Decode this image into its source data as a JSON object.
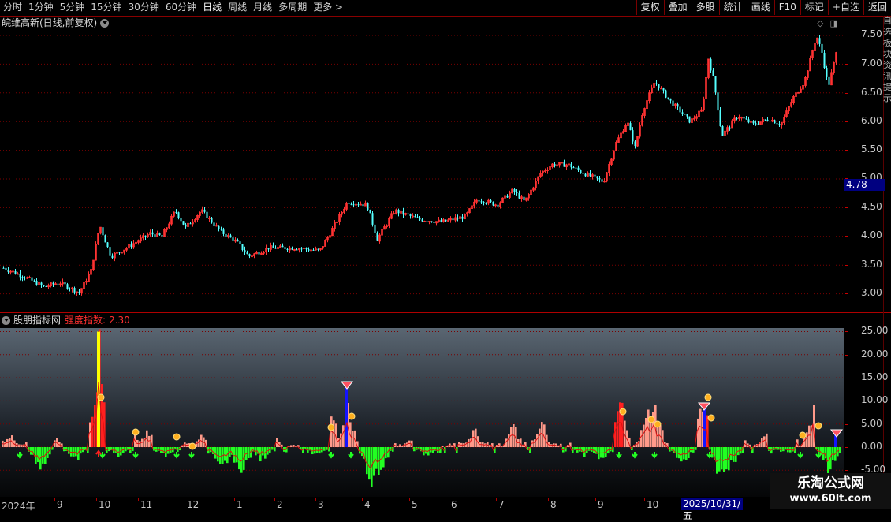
{
  "toolbar": {
    "periods": [
      "分时",
      "1分钟",
      "5分钟",
      "15分钟",
      "30分钟",
      "60分钟",
      "日线",
      "周线",
      "月线",
      "多周期",
      "更多 >"
    ],
    "active_period": "日线",
    "actions": [
      "复权",
      "叠加",
      "多股",
      "统计",
      "画线",
      "F10",
      "标记",
      "+自选",
      "返回"
    ]
  },
  "price_panel": {
    "title": "皖维高新(日线,前复权)",
    "current_price_label": "4.78",
    "y_ticks": [
      "7.50",
      "7.00",
      "6.50",
      "6.00",
      "5.50",
      "5.00",
      "4.50",
      "4.00",
      "3.50",
      "3.00"
    ]
  },
  "indicator_panel": {
    "name": "股朋指标网",
    "label": "强度指数:",
    "value": "2.30",
    "y_ticks": [
      "25.00",
      "20.00",
      "15.00",
      "10.00",
      "5.00",
      "0.00",
      "-5.00"
    ]
  },
  "x_axis": {
    "labels": [
      "2024年",
      "9",
      "10",
      "11",
      "12",
      "1",
      "2",
      "3",
      "4",
      "5",
      "6",
      "7",
      "8",
      "9",
      "10"
    ],
    "selected_date": "2025/10/31/五"
  },
  "right_strip": "自选板块资讯提示",
  "watermark": {
    "line1": "乐淘公式网",
    "line2": "www.60lt.com"
  },
  "colors": {
    "up": "#ff3232",
    "down": "#54ffff",
    "positive_bar": "#ff9a8a",
    "negative_bar": "#22ff22",
    "accent_red": "#ff2020"
  }
}
